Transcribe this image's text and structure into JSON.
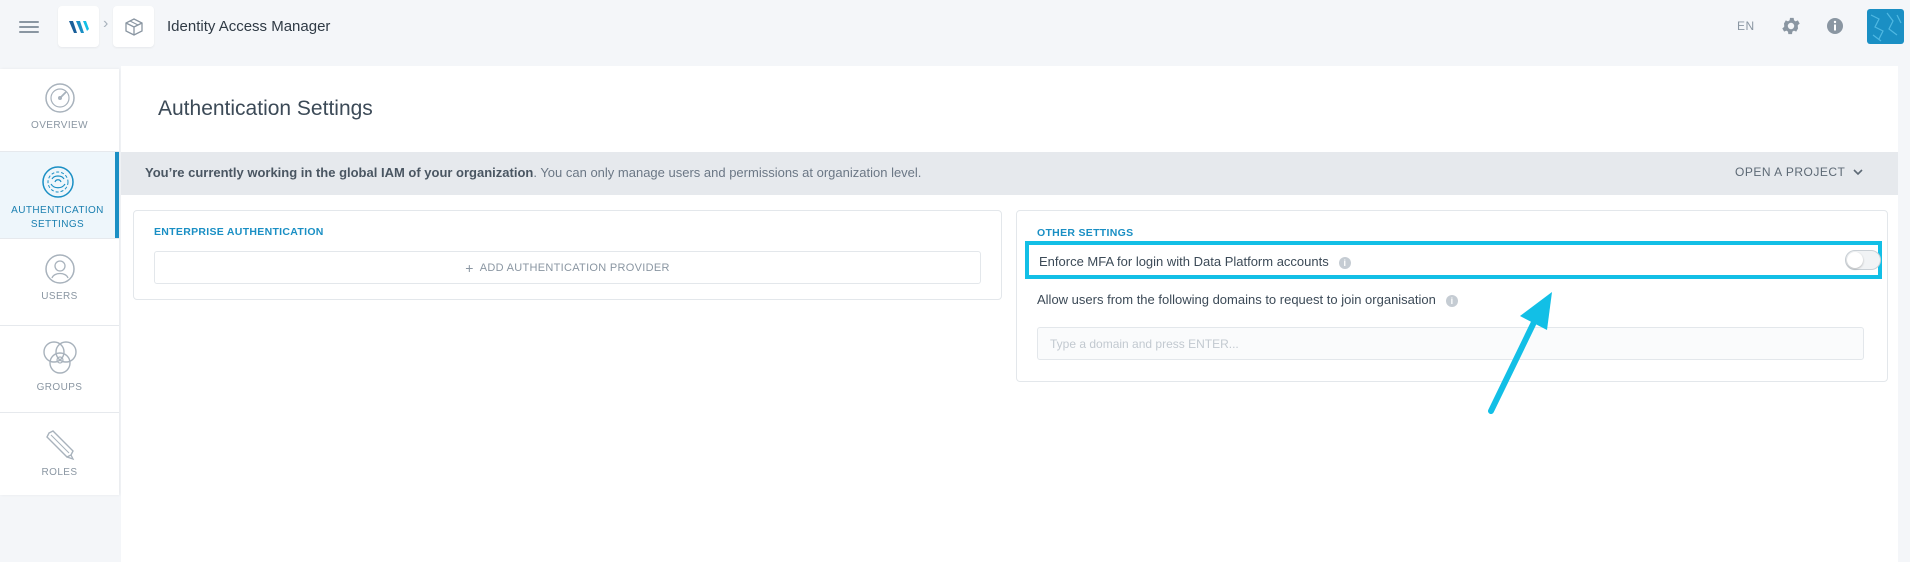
{
  "header": {
    "app_title": "Identity Access Manager",
    "language": "EN"
  },
  "sidebar": {
    "items": [
      {
        "label": "OVERVIEW",
        "icon": "overview-icon"
      },
      {
        "label": "AUTHENTICATION SETTINGS",
        "icon": "authentication-icon",
        "active": true
      },
      {
        "label": "USERS",
        "icon": "users-icon"
      },
      {
        "label": "GROUPS",
        "icon": "groups-icon"
      },
      {
        "label": "ROLES",
        "icon": "roles-icon"
      }
    ]
  },
  "main": {
    "page_title": "Authentication Settings",
    "notice": {
      "bold": "You’re currently working in the global IAM of your organization",
      "rest": ". You can only manage users and permissions at organization level."
    },
    "open_project_label": "OPEN A PROJECT",
    "enterprise_auth": {
      "title": "ENTERPRISE AUTHENTICATION",
      "add_provider_label": "ADD AUTHENTICATION PROVIDER"
    },
    "other_settings": {
      "title": "OTHER SETTINGS",
      "mfa_label": "Enforce MFA for login with Data Platform accounts",
      "mfa_enabled": false,
      "domains_label": "Allow users from the following domains to request to join organisation",
      "domain_placeholder": "Type a domain and press ENTER..."
    }
  },
  "colors": {
    "accent": "#1a8fc4",
    "highlight": "#12bfe6"
  }
}
